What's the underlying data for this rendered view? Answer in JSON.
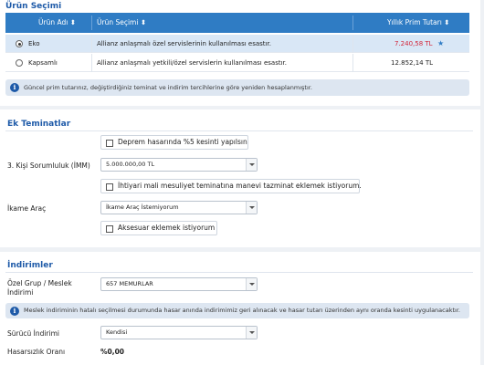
{
  "urun_secimi": {
    "title": "Ürün Seçimi",
    "columns": [
      "Ürün Adı ⬍",
      "Ürün Seçimi ⬍",
      "Yıllık Prim Tutarı ⬍"
    ],
    "rows": [
      {
        "name": "Eko",
        "selected": true,
        "description": "Allianz anlaşmalı özel servislerinin kullanılması esastır.",
        "price": "7.240,58 TL",
        "star": "★"
      },
      {
        "name": "Kapsamlı",
        "selected": false,
        "description": "Allianz anlaşmalı yetkili/özel servislerin kullanılması esastır.",
        "price": "12.852,14 TL",
        "star": ""
      }
    ],
    "info": "Güncel prim tutarınız, değiştirdiğiniz teminat ve indirim tercihlerine göre yeniden hesaplanmıştır."
  },
  "ek_teminatlar": {
    "title": "Ek Teminatlar",
    "deprem_checkbox": "Deprem hasarında %5 kesinti yapılsın",
    "imm_label": "3. Kişi Sorumluluk (İMM)",
    "imm_value": "5.000.000,00 TL",
    "ihtiyari_checkbox": "İhtiyari mali mesuliyet teminatına manevi tazminat eklemek istiyorum.",
    "ikame_label": "İkame Araç",
    "ikame_value": "İkame Araç İstemiyorum",
    "aksesuar_checkbox": "Aksesuar eklemek istiyorum"
  },
  "indirimler": {
    "title": "İndirimler",
    "grup_label_1": "Özel Grup / Meslek",
    "grup_label_2": "İndirimi",
    "grup_value": "657 MEMURLAR",
    "info": "Meslek indiriminin hatalı seçilmesi durumunda hasar anında indirimimiz geri alınacak ve hasar tutarı üzerinden aynı oranda kesinti uygulanacaktır.",
    "surucu_label": "Sürücü İndirimi",
    "surucu_value": "Kendisi",
    "hasarsizlik_label": "Hasarsızlık Oranı",
    "hasarsizlik_value": "%0,00"
  },
  "colors": {
    "accent": "#2f7cc4",
    "heading": "#1e5aa8",
    "price_selected": "#d3263a",
    "star": "#2f7cc4"
  }
}
